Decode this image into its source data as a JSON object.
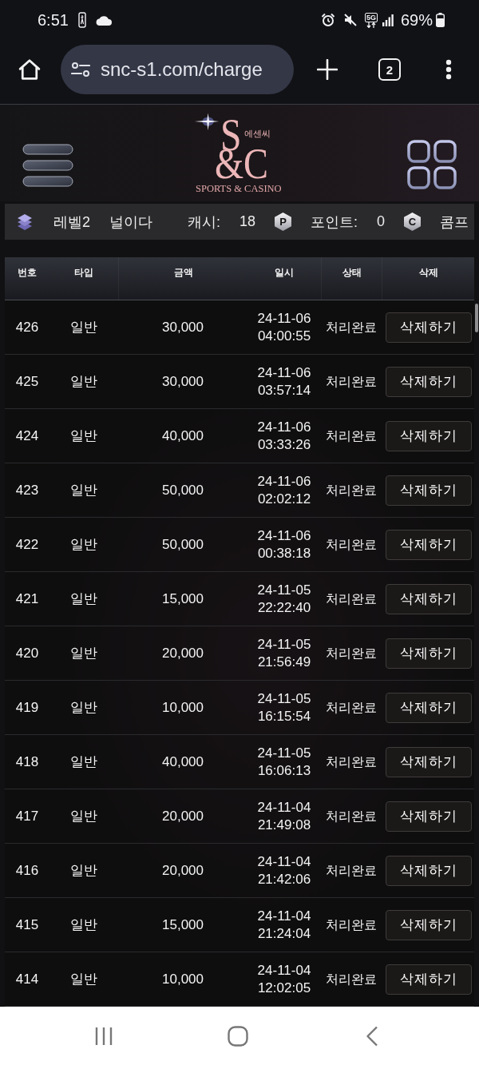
{
  "status_bar": {
    "time": "6:51",
    "network": "5G",
    "battery": "69%"
  },
  "browser": {
    "url": "snc-s1.com/charge",
    "tab_count": "2"
  },
  "header": {
    "logo": {
      "letter_top": "S",
      "letters_bottom": "&C",
      "korean_name": "에센씨",
      "tagline": "SPORTS & CASINO"
    }
  },
  "user_bar": {
    "level": "레벨2",
    "nickname": "널이다",
    "cash_label": "캐시:",
    "cash": "18",
    "points_badge": "P",
    "points_label": "포인트:",
    "points": "0",
    "comp_badge": "C",
    "comp_label": "콤프"
  },
  "table": {
    "columns": [
      "번호",
      "타입",
      "금액",
      "일시",
      "상태",
      "삭제"
    ],
    "rows": [
      {
        "number": "426",
        "type": "일반",
        "amount": "30,000",
        "date": "24-11-06",
        "time": "04:00:55",
        "status": "처리완료",
        "action": "삭제하기"
      },
      {
        "number": "425",
        "type": "일반",
        "amount": "30,000",
        "date": "24-11-06",
        "time": "03:57:14",
        "status": "처리완료",
        "action": "삭제하기"
      },
      {
        "number": "424",
        "type": "일반",
        "amount": "40,000",
        "date": "24-11-06",
        "time": "03:33:26",
        "status": "처리완료",
        "action": "삭제하기"
      },
      {
        "number": "423",
        "type": "일반",
        "amount": "50,000",
        "date": "24-11-06",
        "time": "02:02:12",
        "status": "처리완료",
        "action": "삭제하기"
      },
      {
        "number": "422",
        "type": "일반",
        "amount": "50,000",
        "date": "24-11-06",
        "time": "00:38:18",
        "status": "처리완료",
        "action": "삭제하기"
      },
      {
        "number": "421",
        "type": "일반",
        "amount": "15,000",
        "date": "24-11-05",
        "time": "22:22:40",
        "status": "처리완료",
        "action": "삭제하기"
      },
      {
        "number": "420",
        "type": "일반",
        "amount": "20,000",
        "date": "24-11-05",
        "time": "21:56:49",
        "status": "처리완료",
        "action": "삭제하기"
      },
      {
        "number": "419",
        "type": "일반",
        "amount": "10,000",
        "date": "24-11-05",
        "time": "16:15:54",
        "status": "처리완료",
        "action": "삭제하기"
      },
      {
        "number": "418",
        "type": "일반",
        "amount": "40,000",
        "date": "24-11-05",
        "time": "16:06:13",
        "status": "처리완료",
        "action": "삭제하기"
      },
      {
        "number": "417",
        "type": "일반",
        "amount": "20,000",
        "date": "24-11-04",
        "time": "21:49:08",
        "status": "처리완료",
        "action": "삭제하기"
      },
      {
        "number": "416",
        "type": "일반",
        "amount": "20,000",
        "date": "24-11-04",
        "time": "21:42:06",
        "status": "처리완료",
        "action": "삭제하기"
      },
      {
        "number": "415",
        "type": "일반",
        "amount": "15,000",
        "date": "24-11-04",
        "time": "21:24:04",
        "status": "처리완료",
        "action": "삭제하기"
      },
      {
        "number": "414",
        "type": "일반",
        "amount": "10,000",
        "date": "24-11-04",
        "time": "12:02:05",
        "status": "처리완료",
        "action": "삭제하기"
      }
    ]
  }
}
